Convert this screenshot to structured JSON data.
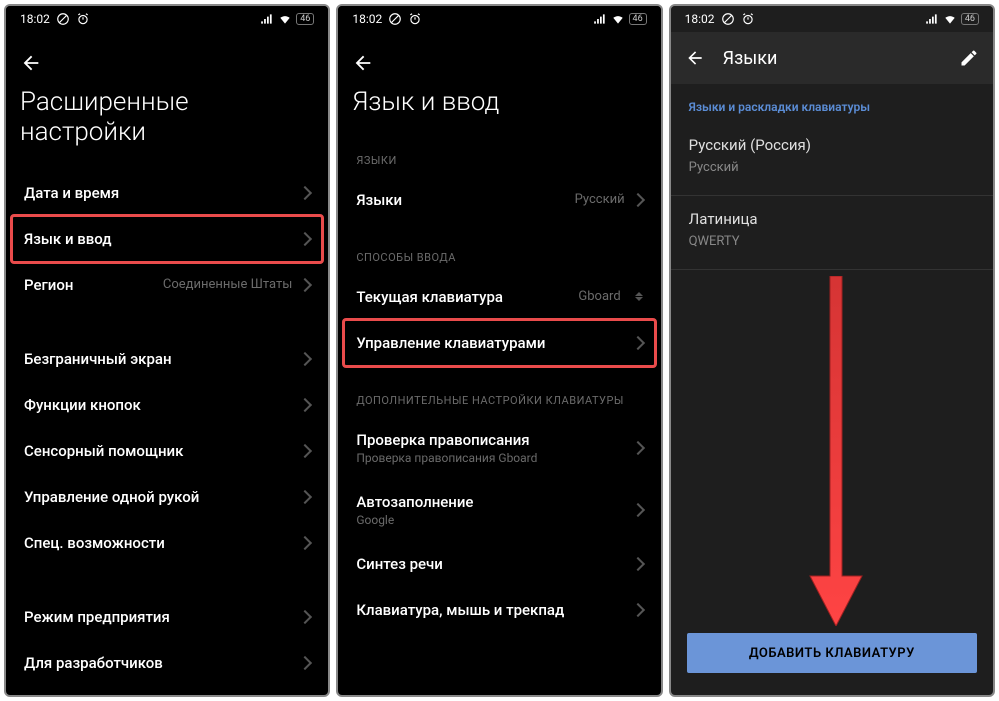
{
  "status": {
    "time": "18:02",
    "battery": "46"
  },
  "phone1": {
    "title": "Расширенные настройки",
    "rows": {
      "datetime": "Дата и время",
      "lang": "Язык и ввод",
      "region": "Регион",
      "region_value": "Соединенные Штаты",
      "edgeless": "Безграничный экран",
      "buttons": "Функции кнопок",
      "assistant": "Сенсорный помощник",
      "onehand": "Управление одной рукой",
      "accessibility": "Спец. возможности",
      "enterprise": "Режим предприятия",
      "developer": "Для разработчиков"
    }
  },
  "phone2": {
    "title": "Язык и ввод",
    "section_languages": "ЯЗЫКИ",
    "rows": {
      "languages": "Языки",
      "languages_value": "Русский"
    },
    "section_input": "СПОСОБЫ ВВОДА",
    "rows2": {
      "current_kb": "Текущая клавиатура",
      "current_kb_value": "Gboard",
      "manage_kb": "Управление клавиатурами"
    },
    "section_extra": "ДОПОЛНИТЕЛЬНЫЕ НАСТРОЙКИ КЛАВИАТУРЫ",
    "rows3": {
      "spellcheck": "Проверка правописания",
      "spellcheck_sub": "Проверка правописания Gboard",
      "autofill": "Автозаполнение",
      "autofill_sub": "Google",
      "tts": "Синтез речи",
      "mouse": "Клавиатура, мышь и трекпад"
    }
  },
  "phone3": {
    "title": "Языки",
    "section": "Языки и раскладки клавиатуры",
    "lang1": "Русский (Россия)",
    "lang1_sub": "Русский",
    "lang2": "Латиница",
    "lang2_sub": "QWERTY",
    "add_button": "ДОБАВИТЬ КЛАВИАТУРУ"
  }
}
